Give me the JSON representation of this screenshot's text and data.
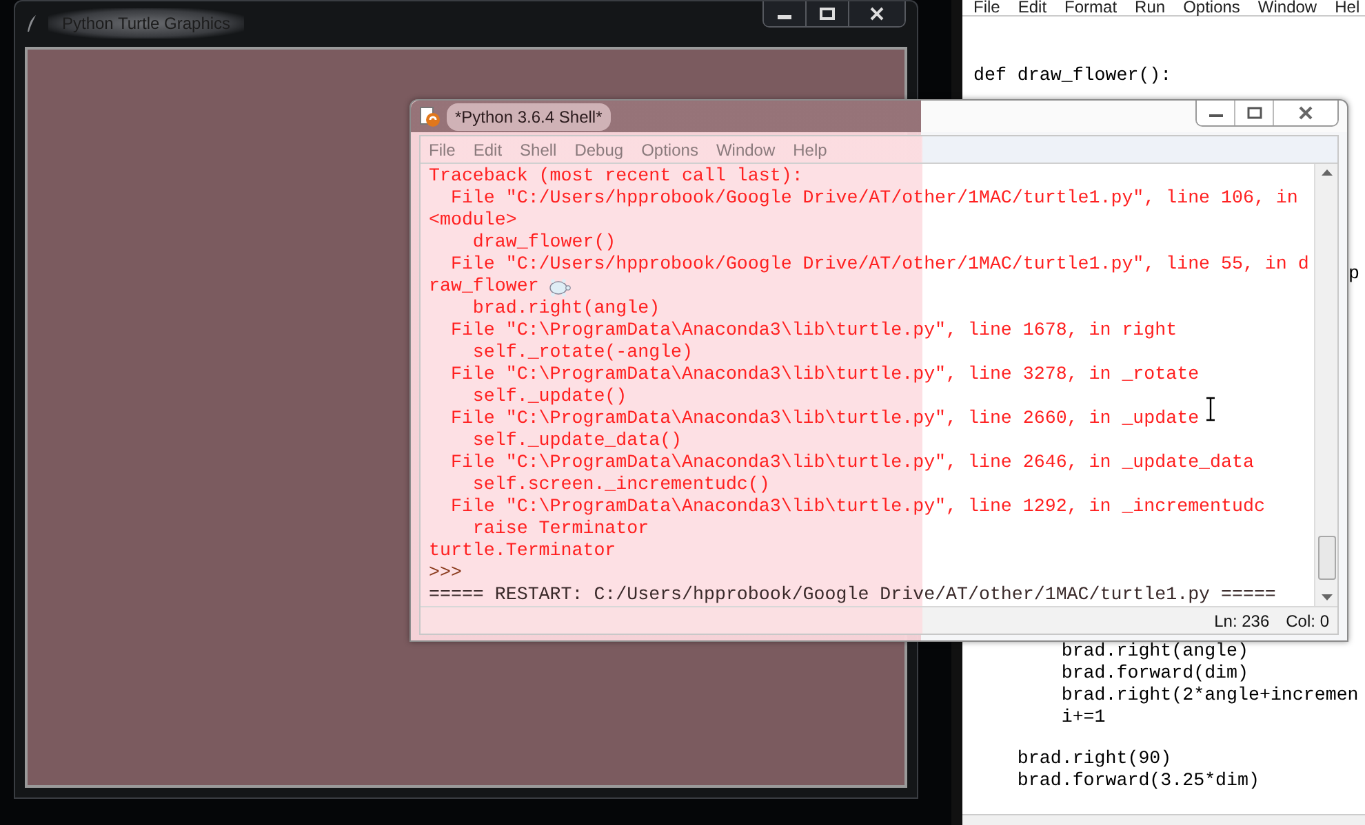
{
  "turtle_window": {
    "title": "Python Turtle Graphics"
  },
  "editor_window": {
    "menu": [
      "File",
      "Edit",
      "Format",
      "Run",
      "Options",
      "Window",
      "Hel"
    ],
    "code_top": [
      {
        "text": "def draw_flower():"
      }
    ],
    "code_fragment": "p",
    "code_block_a": [
      {
        "text": "        brad.right(angle)"
      },
      {
        "text": "        brad.forward(dim)"
      },
      {
        "text": "        brad.right(2*angle+incremen"
      },
      {
        "text": "        i+=1"
      }
    ],
    "code_block_b": [
      {
        "text": "    brad.right(90)"
      },
      {
        "text": "    brad.forward(3.25*dim)"
      }
    ]
  },
  "shell_window": {
    "title": "*Python 3.6.4 Shell*",
    "menu": [
      "File",
      "Edit",
      "Shell",
      "Debug",
      "Options",
      "Window",
      "Help"
    ],
    "lines": [
      {
        "kind": "error",
        "text": "Traceback (most recent call last):"
      },
      {
        "kind": "error",
        "text": "  File \"C:/Users/hpprobook/Google Drive/AT/other/1MAC/turtle1.py\", line 106, in"
      },
      {
        "kind": "error",
        "text": "<module>"
      },
      {
        "kind": "error",
        "text": "    draw_flower()"
      },
      {
        "kind": "error",
        "text": "  File \"C:/Users/hpprobook/Google Drive/AT/other/1MAC/turtle1.py\", line 55, in d"
      },
      {
        "kind": "error",
        "text": "raw_flower"
      },
      {
        "kind": "error",
        "text": "    brad.right(angle)"
      },
      {
        "kind": "error",
        "text": "  File \"C:\\ProgramData\\Anaconda3\\lib\\turtle.py\", line 1678, in right"
      },
      {
        "kind": "error",
        "text": "    self._rotate(-angle)"
      },
      {
        "kind": "error",
        "text": "  File \"C:\\ProgramData\\Anaconda3\\lib\\turtle.py\", line 3278, in _rotate"
      },
      {
        "kind": "error",
        "text": "    self._update()"
      },
      {
        "kind": "error",
        "text": "  File \"C:\\ProgramData\\Anaconda3\\lib\\turtle.py\", line 2660, in _update"
      },
      {
        "kind": "error",
        "text": "    self._update_data()"
      },
      {
        "kind": "error",
        "text": "  File \"C:\\ProgramData\\Anaconda3\\lib\\turtle.py\", line 2646, in _update_data"
      },
      {
        "kind": "error",
        "text": "    self.screen._incrementudc()"
      },
      {
        "kind": "error",
        "text": "  File \"C:\\ProgramData\\Anaconda3\\lib\\turtle.py\", line 1292, in _incrementudc"
      },
      {
        "kind": "error",
        "text": "    raise Terminator"
      },
      {
        "kind": "error",
        "text": "turtle.Terminator"
      },
      {
        "kind": "prompt",
        "text": ">>>"
      },
      {
        "kind": "restart",
        "text": "===== RESTART: C:/Users/hpprobook/Google Drive/AT/other/1MAC/turtle1.py ====="
      }
    ],
    "status": {
      "line": "Ln: 236",
      "col": "Col: 0"
    }
  }
}
